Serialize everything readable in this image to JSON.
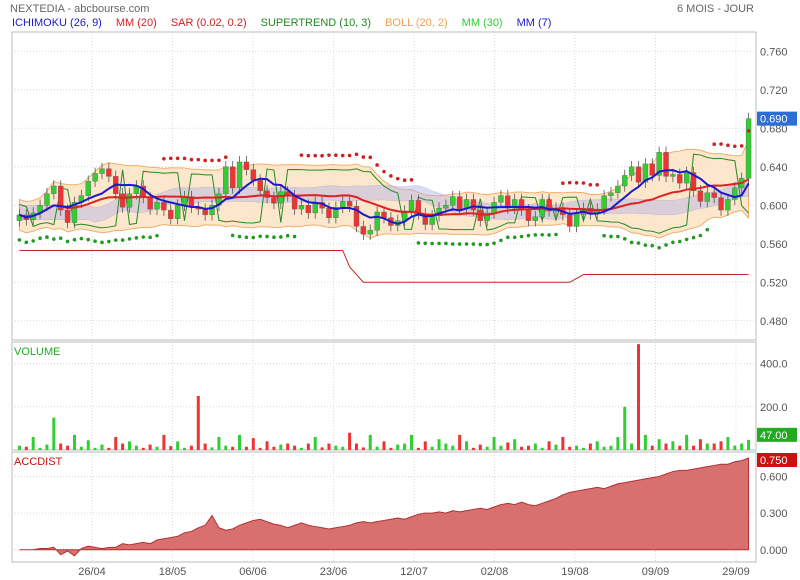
{
  "header": {
    "title": "NEXTEDIA - abcbourse.com",
    "period": "6 MOIS - JOUR"
  },
  "indicators": [
    {
      "label": "ICHIMOKU (26, 9)",
      "color": "#1a1acc"
    },
    {
      "label": "MM (20)",
      "color": "#dd2222"
    },
    {
      "label": "SAR (0.02, 0.2)",
      "color": "#cc2222"
    },
    {
      "label": "SUPERTREND (10, 3)",
      "color": "#228822"
    },
    {
      "label": "BOLL (20, 2)",
      "color": "#f0a050"
    },
    {
      "label": "MM (30)",
      "color": "#33cc33"
    },
    {
      "label": "MM (7)",
      "color": "#1a1acc"
    }
  ],
  "colors": {
    "up": "#33cc33",
    "down": "#ee3333",
    "grid": "#d8d8d8",
    "boll_fill": "#fde3c4",
    "boll_line": "#f0a050",
    "cloud_fill": "#b0b0e8",
    "mm20": "#dd2222",
    "mm7": "#1a1acc",
    "supertrend": "#228822",
    "sar": "#cc2222",
    "sar_low": "#229922",
    "accdist_fill": "#d97070",
    "accdist_line": "#b03030",
    "vol_tag": "#22aa22",
    "price_tag": "#2b6fd6",
    "accdist_tag": "#cc1111"
  },
  "chart_data": [
    {
      "type": "candlestick",
      "title": "",
      "ylim": [
        0.46,
        0.78
      ],
      "yticks": [
        0.48,
        0.52,
        0.56,
        0.6,
        0.64,
        0.68,
        0.72,
        0.76
      ],
      "ytick_labels": [
        "0.480",
        "0.520",
        "0.560",
        "0.600",
        "0.640",
        "0.680",
        "0.720",
        "0.760"
      ],
      "last_value": "0.690",
      "x_labels": [
        "26/04",
        "18/05",
        "06/06",
        "23/06",
        "12/07",
        "02/08",
        "19/08",
        "09/09",
        "29/09"
      ],
      "close": [
        0.59,
        0.585,
        0.592,
        0.6,
        0.612,
        0.62,
        0.595,
        0.582,
        0.603,
        0.61,
        0.625,
        0.633,
        0.638,
        0.63,
        0.612,
        0.598,
        0.612,
        0.62,
        0.608,
        0.596,
        0.603,
        0.595,
        0.586,
        0.6,
        0.609,
        0.598,
        0.596,
        0.59,
        0.6,
        0.612,
        0.64,
        0.618,
        0.645,
        0.637,
        0.626,
        0.615,
        0.608,
        0.602,
        0.614,
        0.61,
        0.596,
        0.6,
        0.592,
        0.603,
        0.597,
        0.587,
        0.598,
        0.604,
        0.599,
        0.578,
        0.57,
        0.574,
        0.593,
        0.587,
        0.579,
        0.584,
        0.594,
        0.605,
        0.591,
        0.58,
        0.589,
        0.597,
        0.6,
        0.609,
        0.596,
        0.606,
        0.595,
        0.584,
        0.592,
        0.603,
        0.61,
        0.597,
        0.606,
        0.595,
        0.584,
        0.588,
        0.606,
        0.594,
        0.597,
        0.59,
        0.578,
        0.591,
        0.597,
        0.591,
        0.596,
        0.61,
        0.613,
        0.62,
        0.631,
        0.64,
        0.624,
        0.643,
        0.631,
        0.655,
        0.63,
        0.632,
        0.623,
        0.634,
        0.615,
        0.604,
        0.613,
        0.608,
        0.595,
        0.606,
        0.618,
        0.628,
        0.69
      ],
      "volume_ylim": [
        0,
        500
      ],
      "volume_yticks": [
        200,
        400
      ],
      "volume_tick_labels": [
        "200.0",
        "400.0"
      ],
      "volume": [
        20,
        15,
        60,
        10,
        25,
        150,
        30,
        20,
        70,
        15,
        45,
        10,
        25,
        10,
        60,
        30,
        40,
        20,
        10,
        25,
        15,
        70,
        18,
        40,
        10,
        20,
        250,
        30,
        12,
        60,
        20,
        15,
        70,
        15,
        55,
        10,
        40,
        15,
        25,
        30,
        20,
        10,
        30,
        60,
        12,
        30,
        20,
        15,
        80,
        30,
        12,
        70,
        15,
        40,
        10,
        25,
        30,
        70,
        10,
        40,
        15,
        50,
        30,
        20,
        70,
        40,
        10,
        25,
        15,
        60,
        20,
        35,
        50,
        15,
        20,
        30,
        10,
        40,
        25,
        60,
        15,
        20,
        10,
        30,
        40,
        15,
        20,
        60,
        200,
        30,
        490,
        70,
        20,
        50,
        30,
        40,
        20,
        70,
        20,
        50,
        30,
        30,
        40,
        60,
        20,
        30,
        47
      ],
      "volume_last": "47.00",
      "accdist_ylim": [
        -0.1,
        0.8
      ],
      "accdist_yticks": [
        0,
        0.3,
        0.6
      ],
      "accdist_tick_labels": [
        "0.000",
        "0.300",
        "0.600"
      ],
      "accdist": [
        0,
        0,
        0,
        0.01,
        0.01,
        0.02,
        -0.04,
        -0.01,
        -0.05,
        0.01,
        0.03,
        0.02,
        0.01,
        0.02,
        0.02,
        0.05,
        0.04,
        0.05,
        0.06,
        0.05,
        0.08,
        0.09,
        0.1,
        0.11,
        0.14,
        0.15,
        0.18,
        0.2,
        0.28,
        0.18,
        0.16,
        0.17,
        0.2,
        0.22,
        0.24,
        0.25,
        0.23,
        0.21,
        0.2,
        0.18,
        0.2,
        0.22,
        0.2,
        0.19,
        0.18,
        0.17,
        0.18,
        0.19,
        0.2,
        0.22,
        0.23,
        0.22,
        0.23,
        0.24,
        0.25,
        0.26,
        0.25,
        0.27,
        0.29,
        0.3,
        0.3,
        0.31,
        0.3,
        0.32,
        0.31,
        0.32,
        0.33,
        0.34,
        0.33,
        0.35,
        0.37,
        0.38,
        0.37,
        0.39,
        0.37,
        0.36,
        0.38,
        0.4,
        0.42,
        0.45,
        0.47,
        0.48,
        0.49,
        0.5,
        0.51,
        0.5,
        0.52,
        0.54,
        0.55,
        0.56,
        0.57,
        0.58,
        0.59,
        0.6,
        0.62,
        0.64,
        0.65,
        0.65,
        0.66,
        0.67,
        0.68,
        0.69,
        0.7,
        0.7,
        0.72,
        0.73,
        0.75
      ],
      "accdist_last": "0.750"
    }
  ],
  "panels": {
    "volume_label": "VOLUME",
    "accdist_label": "ACCDIST"
  }
}
